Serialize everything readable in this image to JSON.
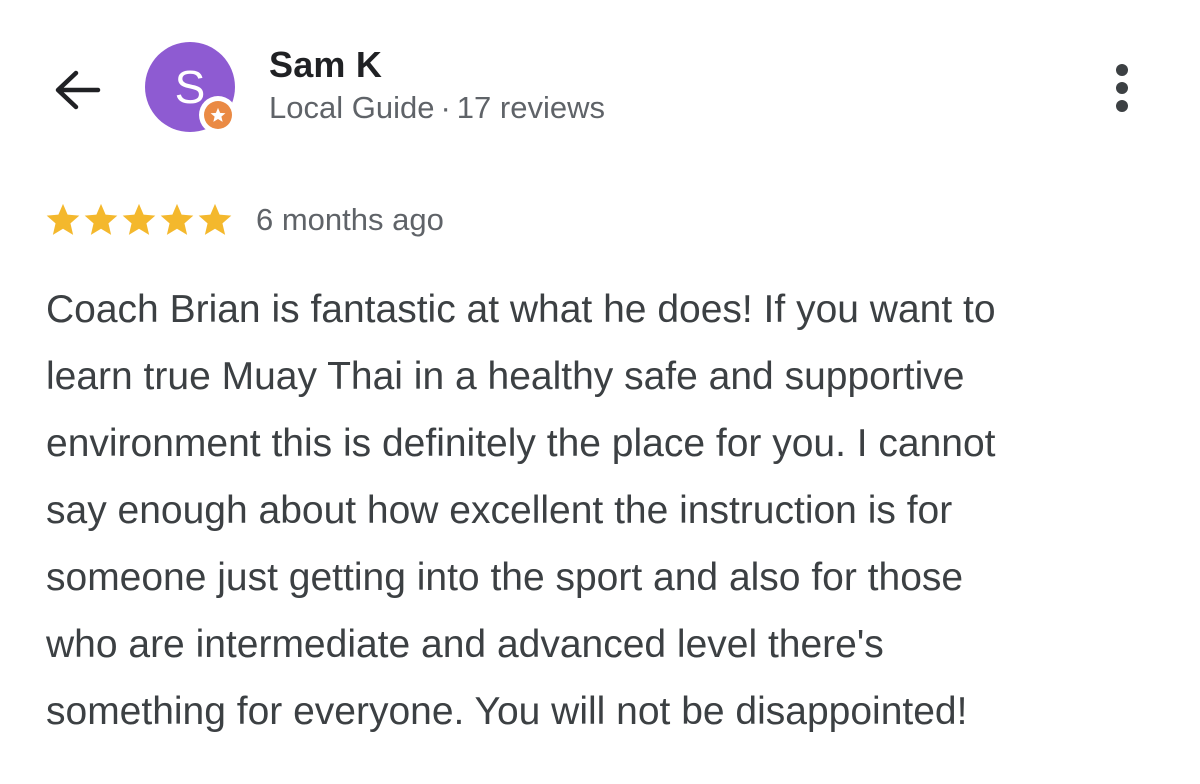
{
  "reviewer": {
    "name": "Sam K",
    "avatar_initial": "S",
    "avatar_color": "#8e5bd2",
    "badge_color": "#ea8a44",
    "role": "Local Guide",
    "separator": "·",
    "review_count": "17 reviews"
  },
  "review": {
    "rating": 5,
    "max_rating": 5,
    "star_color": "#f4b82d",
    "date": "6 months ago",
    "lines": [
      "Coach Brian is fantastic at what he does! If you want to",
      "learn true Muay Thai in a healthy safe and supportive",
      "environment this is definitely the place for you. I cannot",
      "say enough about how excellent the instruction is for",
      "someone just getting into the sport and also for those",
      "who are intermediate and advanced level there's",
      "something for everyone. You will not be disappointed!"
    ]
  },
  "icons": {
    "back": "arrow-left-icon",
    "more": "more-vertical-icon",
    "badge": "local-guide-star-icon",
    "star": "star-icon"
  }
}
